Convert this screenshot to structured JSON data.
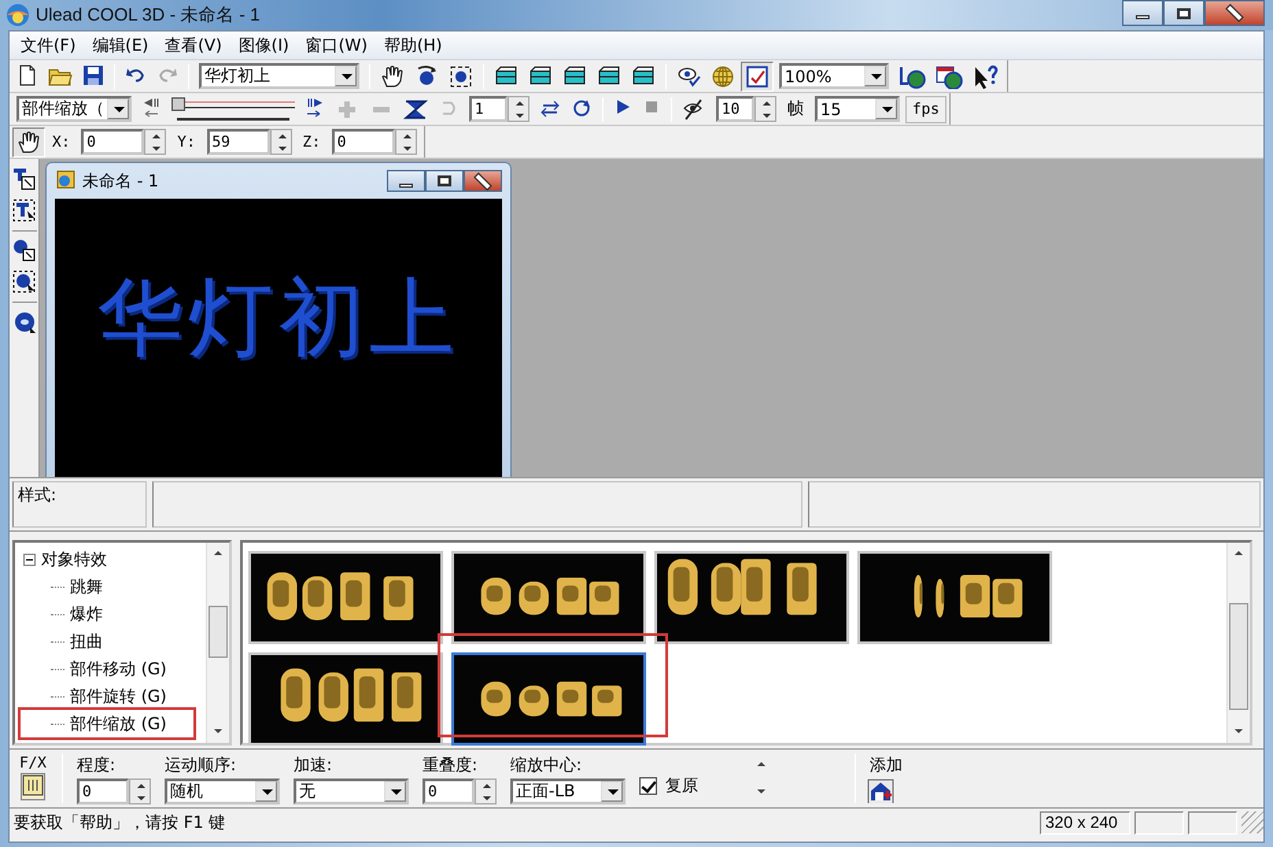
{
  "window": {
    "title": "Ulead COOL 3D - 未命名 - 1"
  },
  "menu": [
    {
      "label": "文件(F)"
    },
    {
      "label": "编辑(E)"
    },
    {
      "label": "查看(V)"
    },
    {
      "label": "图像(I)"
    },
    {
      "label": "窗口(W)"
    },
    {
      "label": "帮助(H)"
    }
  ],
  "toolbar": {
    "text_combo": "华灯初上",
    "zoom_combo": "100%"
  },
  "animation_bar": {
    "effect_combo": "部件缩放（",
    "level": 0,
    "frame": "1",
    "frame_count": "10",
    "frames_label": "帧",
    "fps_combo": "15",
    "fps_button": "fps"
  },
  "position_bar": {
    "fields": [
      {
        "label": "X:",
        "value": "0"
      },
      {
        "label": "Y:",
        "value": "59"
      },
      {
        "label": "Z:",
        "value": "0"
      }
    ]
  },
  "document": {
    "title": "未命名 - 1",
    "text": "华灯初上"
  },
  "style_panel": {
    "label": "样式:"
  },
  "effects_tree": {
    "label": "对象特效",
    "expanded": true,
    "children": [
      {
        "label": "跳舞",
        "highlighted": false
      },
      {
        "label": "爆炸",
        "highlighted": false
      },
      {
        "label": "扭曲",
        "highlighted": false
      },
      {
        "label": "部件移动 (G)",
        "highlighted": false
      },
      {
        "label": "部件旋转 (G)",
        "highlighted": false
      },
      {
        "label": "部件缩放 (G)",
        "highlighted": true
      }
    ]
  },
  "thumbnails": [
    {
      "kind": "picture",
      "selected": false,
      "highlighted": false
    },
    {
      "kind": "picture",
      "selected": false,
      "highlighted": false
    },
    {
      "kind": "picture",
      "selected": false,
      "highlighted": false
    },
    {
      "kind": "picture",
      "selected": false,
      "highlighted": false
    },
    {
      "kind": "picture",
      "selected": false,
      "highlighted": false
    },
    {
      "kind": "picture",
      "selected": true,
      "highlighted": true
    }
  ],
  "parameters": {
    "fx_label": "F/X",
    "fields": [
      {
        "kind": "spin",
        "label": "程度:",
        "value": "0"
      },
      {
        "kind": "combo",
        "label": "运动顺序:",
        "value": "随机"
      },
      {
        "kind": "combo",
        "label": "加速:",
        "value": "无"
      },
      {
        "kind": "spin",
        "label": "重叠度:",
        "value": "0"
      },
      {
        "kind": "combo",
        "label": "缩放中心:",
        "value": "正面-LB"
      }
    ],
    "reset": {
      "label": "复原",
      "checked": true
    },
    "add_label": "添加"
  },
  "status_bar": {
    "message": "要获取「帮助」，请按 F1 键",
    "size": "320 x 240"
  }
}
